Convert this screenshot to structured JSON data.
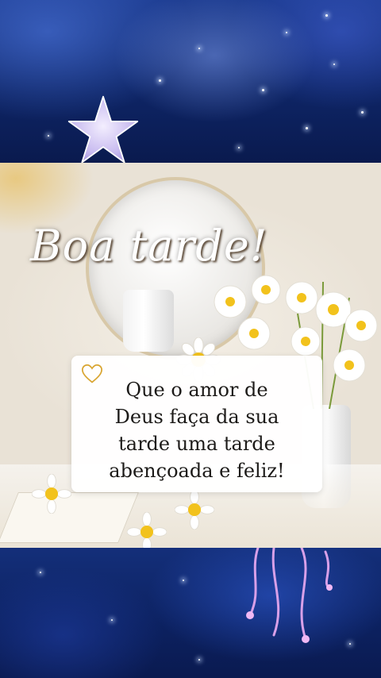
{
  "greeting": "Boa tarde!",
  "message": {
    "lines": [
      "Que o amor de",
      "Deus faça da sua",
      "tarde uma tarde",
      "abençoada e feliz!"
    ]
  },
  "icons": {
    "starfish": "starfish-icon",
    "heart": "heart-outline-icon",
    "daisy": "daisy-flower-icon"
  },
  "colors": {
    "sky_dark": "#0b1a4a",
    "sky_mid": "#1b3a8e",
    "card_bg": "#ffffff",
    "text": "#1c1a18",
    "heart_gold": "#d9a531",
    "starfish": "#d7ccf6"
  }
}
